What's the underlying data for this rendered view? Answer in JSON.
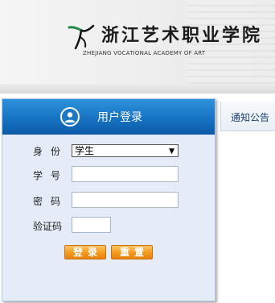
{
  "header": {
    "school_name": "浙江艺术职业学院",
    "school_name_en": "ZHEJIANG VOCATIONAL ACADEMY OF ART"
  },
  "login": {
    "title": "用户登录",
    "identity_label": "身份",
    "identity_value": "学生",
    "student_id_label": "学号",
    "password_label": "密码",
    "captcha_label": "验证码",
    "login_button": "登录",
    "reset_button": "重置"
  },
  "notice": {
    "tab_label": "通知公告"
  },
  "colors": {
    "title_bar": "#1773c2",
    "panel_bg": "#e5ecf7",
    "button": "#f39a1e"
  }
}
